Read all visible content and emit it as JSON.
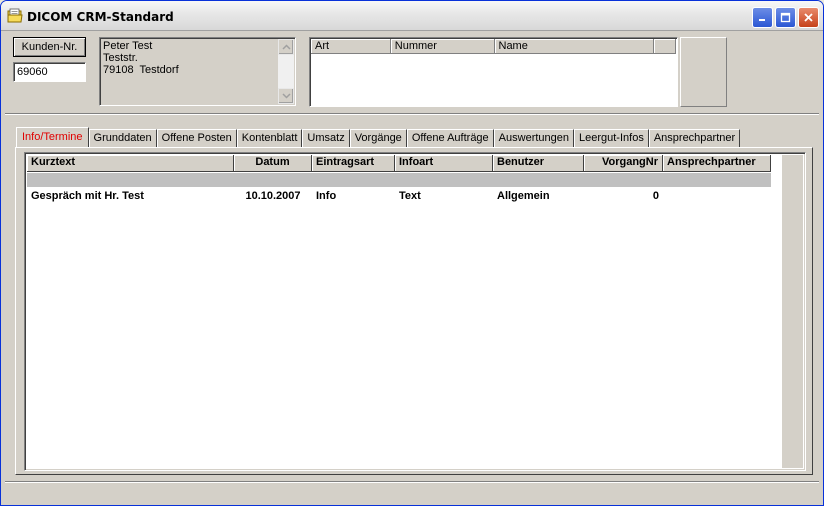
{
  "window": {
    "title": "DICOM CRM-Standard"
  },
  "customer": {
    "button_label": "Kunden-Nr.",
    "number": "69060",
    "address_lines": [
      "Peter Test",
      "Teststr.",
      "79108  Testdorf"
    ]
  },
  "contacts_list": {
    "columns": [
      "Art",
      "Nummer",
      "Name"
    ]
  },
  "tabs": [
    {
      "label": "Info/Termine",
      "active": true
    },
    {
      "label": "Grunddaten"
    },
    {
      "label": "Offene Posten"
    },
    {
      "label": "Kontenblatt"
    },
    {
      "label": "Umsatz"
    },
    {
      "label": "Vorgänge"
    },
    {
      "label": "Offene Aufträge"
    },
    {
      "label": "Auswertungen"
    },
    {
      "label": "Leergut-Infos"
    },
    {
      "label": "Ansprechpartner"
    }
  ],
  "grid": {
    "columns": [
      "Kurztext",
      "Datum",
      "Eintragsart",
      "Infoart",
      "Benutzer",
      "VorgangNr",
      "Ansprechpartner"
    ],
    "rows": [
      {
        "kurztext": "Gespräch mit Hr. Test",
        "datum": "10.10.2007",
        "eintragsart": "Info",
        "infoart": "Text",
        "benutzer": "Allgemein",
        "vorgangnr": "0",
        "ansprechpartner": ""
      }
    ]
  },
  "colors": {
    "active_tab_text": "#e00000",
    "face": "#d4d0c8"
  }
}
